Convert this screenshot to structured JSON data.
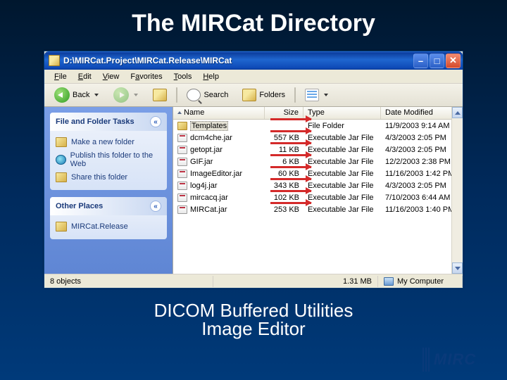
{
  "slide": {
    "title": "The MIRCat Directory",
    "caption_line1": "DICOM Buffered Utilities",
    "caption_line2": "Image Editor"
  },
  "logo": {
    "text": "MIRC"
  },
  "window": {
    "title": "D:\\MIRCat.Project\\MIRCat.Release\\MIRCat",
    "menus": {
      "file": "File",
      "edit": "Edit",
      "view": "View",
      "favorites": "Favorites",
      "tools": "Tools",
      "help": "Help"
    },
    "toolbar": {
      "back": "Back",
      "search": "Search",
      "folders": "Folders"
    },
    "sidebar": {
      "panel1": {
        "title": "File and Folder Tasks",
        "links": {
          "newfolder": "Make a new folder",
          "publish": "Publish this folder to the Web",
          "share": "Share this folder"
        }
      },
      "panel2": {
        "title": "Other Places",
        "links": {
          "release": "MIRCat.Release"
        }
      }
    },
    "columns": {
      "name": "Name",
      "size": "Size",
      "type": "Type",
      "date": "Date Modified"
    },
    "files": [
      {
        "name": "Templates",
        "size": "",
        "type": "File Folder",
        "date": "11/9/2003 9:14 AM"
      },
      {
        "name": "dcm4che.jar",
        "size": "557 KB",
        "type": "Executable Jar File",
        "date": "4/3/2003 2:05 PM"
      },
      {
        "name": "getopt.jar",
        "size": "11 KB",
        "type": "Executable Jar File",
        "date": "4/3/2003 2:05 PM"
      },
      {
        "name": "GIF.jar",
        "size": "6 KB",
        "type": "Executable Jar File",
        "date": "12/2/2003 2:38 PM"
      },
      {
        "name": "ImageEditor.jar",
        "size": "60 KB",
        "type": "Executable Jar File",
        "date": "11/16/2003 1:42 PM"
      },
      {
        "name": "log4j.jar",
        "size": "343 KB",
        "type": "Executable Jar File",
        "date": "4/3/2003 2:05 PM"
      },
      {
        "name": "mircacq.jar",
        "size": "102 KB",
        "type": "Executable Jar File",
        "date": "7/10/2003 6:44 AM"
      },
      {
        "name": "MIRCat.jar",
        "size": "253 KB",
        "type": "Executable Jar File",
        "date": "11/16/2003 1:40 PM"
      }
    ],
    "status": {
      "objects": "8 objects",
      "size": "1.31 MB",
      "location": "My Computer"
    }
  }
}
